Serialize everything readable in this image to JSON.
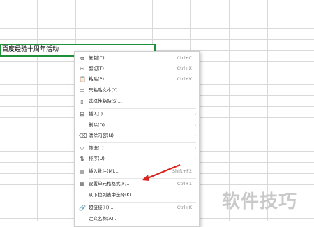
{
  "sheet": {
    "cell_text": "百度经验十周年活动"
  },
  "context_menu": {
    "items": [
      {
        "icon": "copy-icon",
        "glyph": "⧉",
        "label": "复制(C)",
        "shortcut": "Ctrl+C"
      },
      {
        "icon": "cut-icon",
        "glyph": "✂",
        "label": "剪切(T)",
        "shortcut": "Ctrl+X"
      },
      {
        "icon": "paste-icon",
        "glyph": "📋",
        "label": "粘贴(P)",
        "shortcut": "Ctrl+V"
      },
      {
        "icon": "paste-text-icon",
        "glyph": "▭",
        "label": "只粘贴文本(Y)",
        "shortcut": ""
      },
      {
        "icon": "paste-special-icon",
        "glyph": "▯",
        "label": "选择性粘贴(S)...",
        "shortcut": ""
      },
      {
        "icon": "insert-icon",
        "glyph": "⊞",
        "label": "插入(I)",
        "shortcut": ""
      },
      {
        "icon": "delete-icon",
        "glyph": "",
        "label": "删除(D)",
        "shortcut": ""
      },
      {
        "icon": "clear-content-icon",
        "glyph": "⌫",
        "label": "清除内容(N)",
        "shortcut": ""
      },
      {
        "icon": "filter-icon",
        "glyph": "▽",
        "label": "筛选(L)",
        "shortcut": ""
      },
      {
        "icon": "sort-icon",
        "glyph": "⇅",
        "label": "排序(U)",
        "shortcut": ""
      },
      {
        "icon": "comment-icon",
        "glyph": "▤",
        "label": "插入批注(M)...",
        "shortcut": "Shift+F2"
      },
      {
        "icon": "format-cells-icon",
        "glyph": "▦",
        "label": "设置单元格格式(F)...",
        "shortcut": "Ctrl+1"
      },
      {
        "icon": "dropdown-list-icon",
        "glyph": "",
        "label": "从下拉列表中选择(K)...",
        "shortcut": ""
      },
      {
        "icon": "hyperlink-icon",
        "glyph": "🔗",
        "label": "超链接(H)...",
        "shortcut": "Ctrl+K"
      },
      {
        "icon": "define-name-icon",
        "glyph": "",
        "label": "定义名称(A)...",
        "shortcut": ""
      }
    ]
  },
  "colors": {
    "selection_border": "#1f8f3a",
    "annotation_arrow": "#d9231c"
  },
  "watermark": "软件技巧"
}
